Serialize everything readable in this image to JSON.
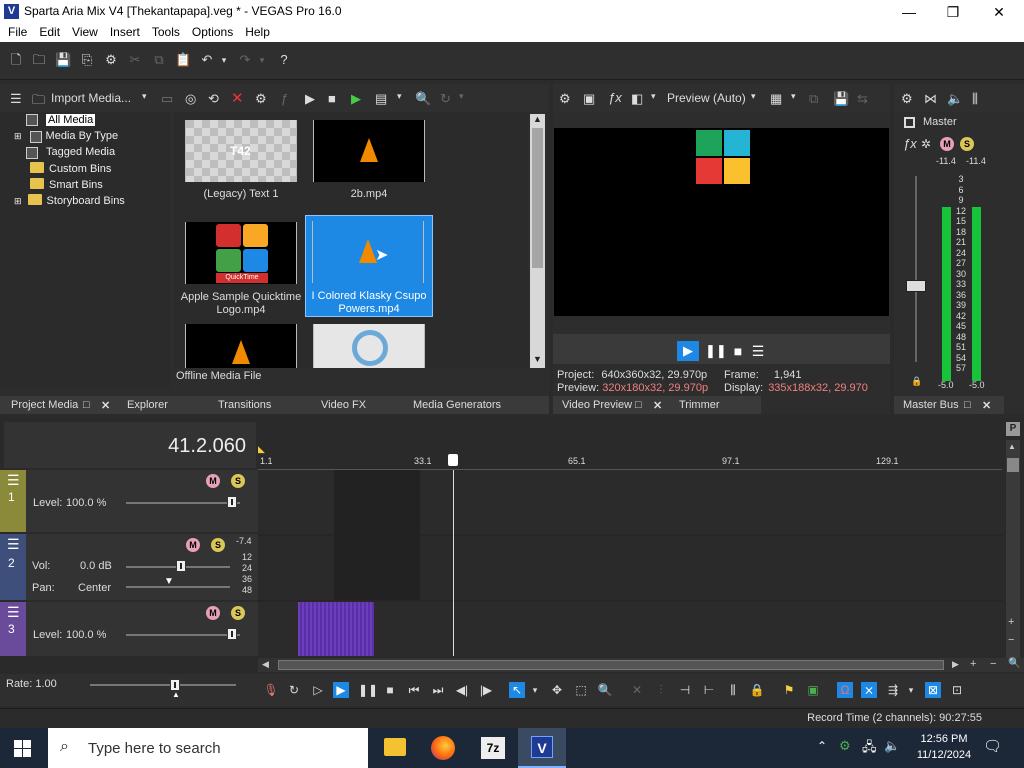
{
  "titlebar": {
    "title": "Sparta Aria Mix V4 [Thekantapapa].veg * - VEGAS Pro 16.0",
    "logo": "V"
  },
  "menu": [
    "File",
    "Edit",
    "View",
    "Insert",
    "Tools",
    "Options",
    "Help"
  ],
  "project_media": {
    "toolbar_label": "Import Media...",
    "tree": [
      "All Media",
      "Media By Type",
      "Tagged Media",
      "Custom Bins",
      "Smart Bins",
      "Storyboard Bins"
    ],
    "items": [
      {
        "caption": "(Legacy) Text 1",
        "thumb_text": "T42"
      },
      {
        "caption": "2b.mp4"
      },
      {
        "caption": "Apple Sample Quicktime Logo.mp4",
        "thumb_text": "QuickTime"
      },
      {
        "caption": "I Colored Klasky Csupo Powers.mp4"
      }
    ],
    "status": "Offline Media File",
    "tabs": [
      "Project Media",
      "Explorer",
      "Transitions",
      "Video FX",
      "Media Generators"
    ]
  },
  "preview": {
    "mode": "Preview (Auto)",
    "project_label": "Project:",
    "project_value": "640x360x32, 29.970p",
    "preview_label": "Preview:",
    "preview_value": "320x180x32, 29.970p",
    "frame_label": "Frame:",
    "frame_value": "1,941",
    "display_label": "Display:",
    "display_value": "335x188x32, 29.970",
    "tabs": [
      "Video Preview",
      "Trimmer"
    ]
  },
  "master": {
    "label": "Master",
    "peak_left": "-11.4",
    "peak_right": "-11.4",
    "scale": [
      "3",
      "6",
      "9",
      "12",
      "15",
      "18",
      "21",
      "24",
      "27",
      "30",
      "33",
      "36",
      "39",
      "42",
      "45",
      "48",
      "51",
      "54",
      "57"
    ],
    "bottom_left": "-5.0",
    "bottom_right": "-5.0",
    "tab": "Master Bus"
  },
  "timeline": {
    "time": "41.2.060",
    "ruler": [
      "1.1",
      "33.1",
      "65.1",
      "97.1",
      "129.1"
    ],
    "tracks": [
      {
        "num": "1",
        "level_label": "Level:",
        "level_value": "100.0 %"
      },
      {
        "num": "2",
        "vol_label": "Vol:",
        "vol_value": "0.0 dB",
        "pan_label": "Pan:",
        "pan_value": "Center",
        "meter_top": "-7.4",
        "meter_scale": [
          "12",
          "24",
          "36",
          "48"
        ]
      },
      {
        "num": "3",
        "level_label": "Level:",
        "level_value": "100.0 %"
      }
    ],
    "rate_label": "Rate: 1.00",
    "record_time": "Record Time (2 channels): 90:27:55"
  },
  "taskbar": {
    "search_placeholder": "Type here to search",
    "time": "12:56 PM",
    "date": "11/12/2024",
    "app_7z": "7z",
    "app_v": "V"
  },
  "colors": {
    "accent": "#1e88e5",
    "meter": "#17c43a",
    "track1": "#8a8a3a",
    "track2": "#3d4f7a",
    "track3": "#6a4a9a",
    "clip": "#6a3fb8"
  }
}
